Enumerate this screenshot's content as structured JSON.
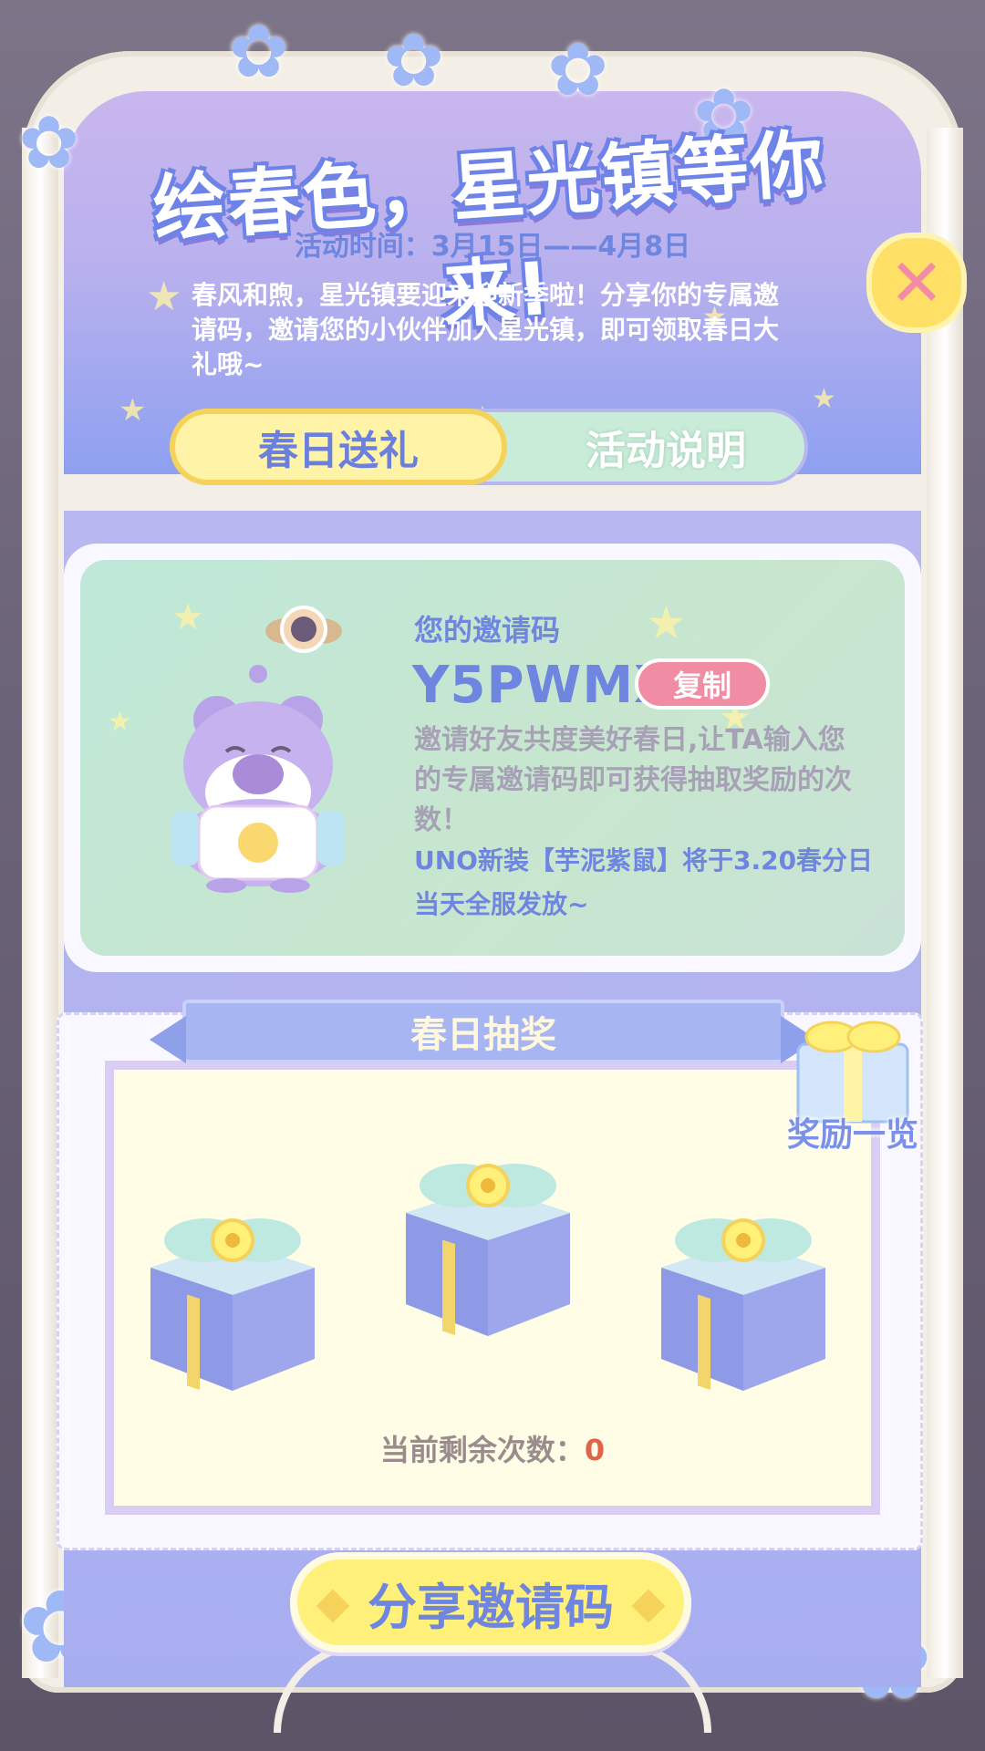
{
  "header": {
    "title": "绘春色，星光镇等你来!",
    "event_time": "活动时间：3月15日——4月8日",
    "description": "春风和煦，星光镇要迎来迎新季啦！分享你的专属邀请码，邀请您的小伙伴加入星光镇，即可领取春日大礼哦~"
  },
  "tabs": [
    {
      "label": "春日送礼",
      "active": true
    },
    {
      "label": "活动说明",
      "active": false
    }
  ],
  "invite": {
    "label": "您的邀请码",
    "code": "Y5PWMX",
    "copy_label": "复制",
    "text": "邀请好友共度美好春日,让TA输入您的专属邀请码即可获得抽取奖励的次数！",
    "note": "UNO新装【芋泥紫鼠】将于3.20春分日当天全服发放~"
  },
  "lottery": {
    "title": "春日抽奖",
    "reward_list_label": "奖励一览",
    "remaining_label": "当前剩余次数：",
    "remaining_count": "0"
  },
  "share_button_label": "分享邀请码",
  "colors": {
    "accent_blue": "#6f86e0",
    "button_yellow": "#fff07a",
    "copy_pink": "#f08da5",
    "card_green": "#c8e6cf",
    "remaining_red": "#e06548"
  },
  "icons": {
    "close": "close-icon",
    "gift_box": "gift-box-icon",
    "reward_list": "gift-icon"
  }
}
